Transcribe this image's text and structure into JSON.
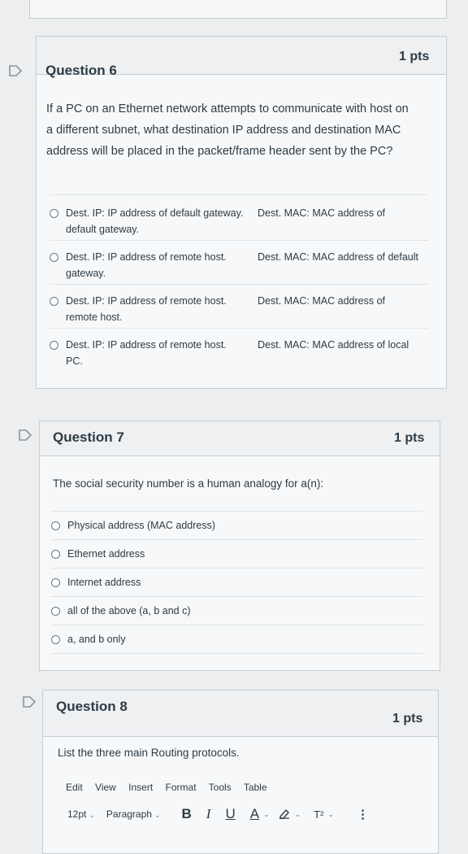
{
  "questions": [
    {
      "title": "Question 6",
      "points": "1 pts",
      "text": [
        "If a PC on an Ethernet network attempts to communicate with host on",
        "a different subnet, what destination IP address and destination MAC",
        "address will be placed in the packet/frame header sent by the PC?"
      ],
      "answers": [
        {
          "ip": "Dest. IP: IP address of default gateway.",
          "ip2": "default gateway.",
          "mac": "Dest. MAC: MAC address of"
        },
        {
          "ip": "Dest. IP: IP address of remote host.",
          "ip2": "gateway.",
          "mac": "Dest. MAC: MAC address of default"
        },
        {
          "ip": "Dest. IP: IP address of remote host.",
          "ip2": "remote host.",
          "mac": "Dest. MAC: MAC address of"
        },
        {
          "ip": "Dest. IP: IP address of remote host.",
          "ip2": "PC.",
          "mac": "Dest. MAC: MAC address of local"
        }
      ]
    },
    {
      "title": "Question 7",
      "points": "1 pts",
      "text": "The social security number is a human analogy for a(n):",
      "answers": [
        "Physical address (MAC address)",
        "Ethernet address",
        "Internet address",
        "all of the above (a, b and c)",
        "a, and b only"
      ]
    },
    {
      "title": "Question 8",
      "points": "1 pts",
      "text": "List the three main Routing protocols."
    }
  ],
  "editor": {
    "menu": [
      "Edit",
      "View",
      "Insert",
      "Format",
      "Tools",
      "Table"
    ],
    "font_size": "12pt",
    "block_format": "Paragraph",
    "buttons": {
      "bold": "B",
      "italic": "I",
      "underline": "U",
      "color": "A",
      "superscript": "T²",
      "more": "⋮"
    }
  }
}
